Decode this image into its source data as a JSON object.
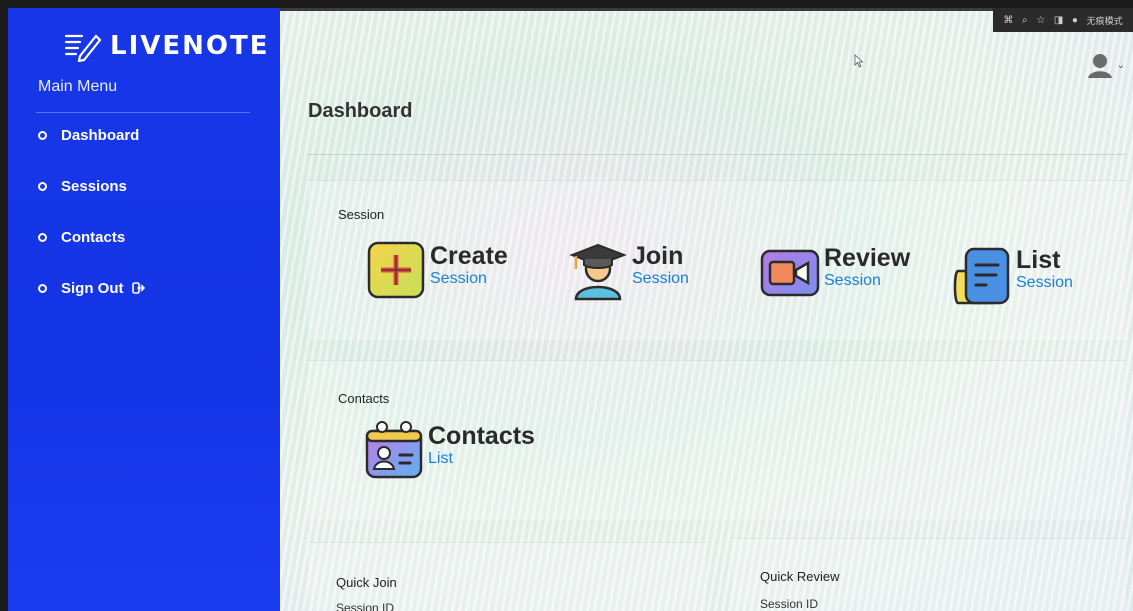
{
  "app": {
    "brand": "LIVENOTE"
  },
  "sidebar": {
    "menu_title": "Main Menu",
    "items": [
      {
        "label": "Dashboard"
      },
      {
        "label": "Sessions"
      },
      {
        "label": "Contacts"
      },
      {
        "label": "Sign Out"
      }
    ]
  },
  "browser": {
    "profile_label": "无痕模式"
  },
  "main": {
    "page_title": "Dashboard",
    "session_section": {
      "label": "Session",
      "actions": [
        {
          "title": "Create",
          "subtitle": "Session",
          "icon": "plus-icon"
        },
        {
          "title": "Join",
          "subtitle": "Session",
          "icon": "graduate-icon"
        },
        {
          "title": "Review",
          "subtitle": "Session",
          "icon": "video-camera-icon"
        },
        {
          "title": "List",
          "subtitle": "Session",
          "icon": "document-list-icon"
        }
      ]
    },
    "contacts_section": {
      "label": "Contacts",
      "actions": [
        {
          "title": "Contacts",
          "subtitle": "List",
          "icon": "contact-card-icon"
        }
      ]
    },
    "quick_join": {
      "label": "Quick Join",
      "field_label": "Session ID"
    },
    "quick_review": {
      "label": "Quick Review",
      "field_label": "Session ID"
    }
  },
  "colors": {
    "sidebar": "#1736e8",
    "accent_link": "#1b7fd6",
    "heading": "#2a2a2a"
  }
}
